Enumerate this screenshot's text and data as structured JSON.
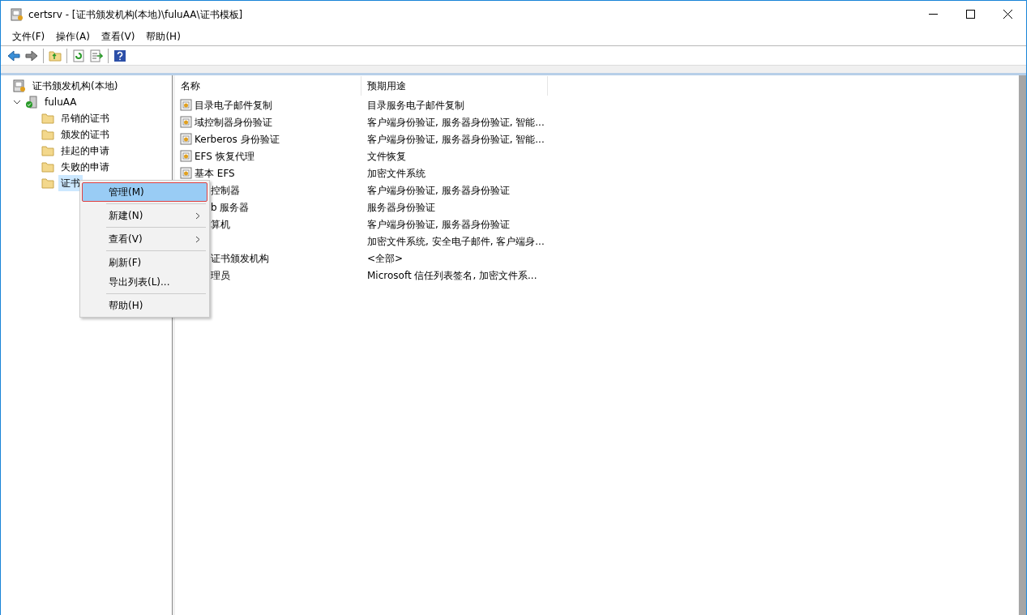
{
  "window": {
    "title": "certsrv - [证书颁发机构(本地)\\fuluAA\\证书模板]"
  },
  "menu_bar": [
    "文件(F)",
    "操作(A)",
    "查看(V)",
    "帮助(H)"
  ],
  "tree": {
    "label": "证书颁发机构(本地)",
    "children": [
      {
        "label": "fuluAA",
        "expanded": true,
        "children": [
          {
            "label": "吊销的证书",
            "selected": false
          },
          {
            "label": "颁发的证书",
            "selected": false
          },
          {
            "label": "挂起的申请",
            "selected": false
          },
          {
            "label": "失败的申请",
            "selected": false
          },
          {
            "label": "证书",
            "selected": true
          }
        ]
      }
    ]
  },
  "table": {
    "columns": [
      "名称",
      "预期用途"
    ],
    "rows": [
      {
        "kind": "full",
        "name": "目录电子邮件复制",
        "purpose": "目录服务电子邮件复制"
      },
      {
        "kind": "full",
        "name": "域控制器身份验证",
        "purpose": "客户端身份验证, 服务器身份验证, 智能..."
      },
      {
        "kind": "full",
        "name": "Kerberos 身份验证",
        "purpose": "客户端身份验证, 服务器身份验证, 智能..."
      },
      {
        "kind": "full",
        "name": "EFS 恢复代理",
        "purpose": "文件恢复"
      },
      {
        "kind": "full",
        "name": "基本 EFS",
        "purpose": "加密文件系统"
      },
      {
        "kind": "covered",
        "name": "控制器",
        "purpose": "客户端身份验证, 服务器身份验证"
      },
      {
        "kind": "covered",
        "name": "b 服务器",
        "purpose": "服务器身份验证"
      },
      {
        "kind": "covered",
        "name": "算机",
        "purpose": "客户端身份验证, 服务器身份验证"
      },
      {
        "kind": "covered",
        "purpose": "加密文件系统, 安全电子邮件, 客户端身..."
      },
      {
        "kind": "covered",
        "name": "证书颁发机构",
        "purpose": "<全部>"
      },
      {
        "kind": "covered",
        "name": "理员",
        "purpose": "Microsoft 信任列表签名, 加密文件系..."
      }
    ]
  },
  "context_menu": [
    {
      "kind": "item",
      "label": "管理(M)",
      "selected": true,
      "submenu": false
    },
    {
      "kind": "separator"
    },
    {
      "kind": "item",
      "label": "新建(N)",
      "selected": false,
      "submenu": true
    },
    {
      "kind": "separator"
    },
    {
      "kind": "item",
      "label": "查看(V)",
      "selected": false,
      "submenu": true
    },
    {
      "kind": "separator"
    },
    {
      "kind": "item",
      "label": "刷新(F)",
      "selected": false,
      "submenu": false
    },
    {
      "kind": "item",
      "label": "导出列表(L)...",
      "selected": false,
      "submenu": false
    },
    {
      "kind": "separator"
    },
    {
      "kind": "item",
      "label": "帮助(H)",
      "selected": false,
      "submenu": false
    }
  ]
}
